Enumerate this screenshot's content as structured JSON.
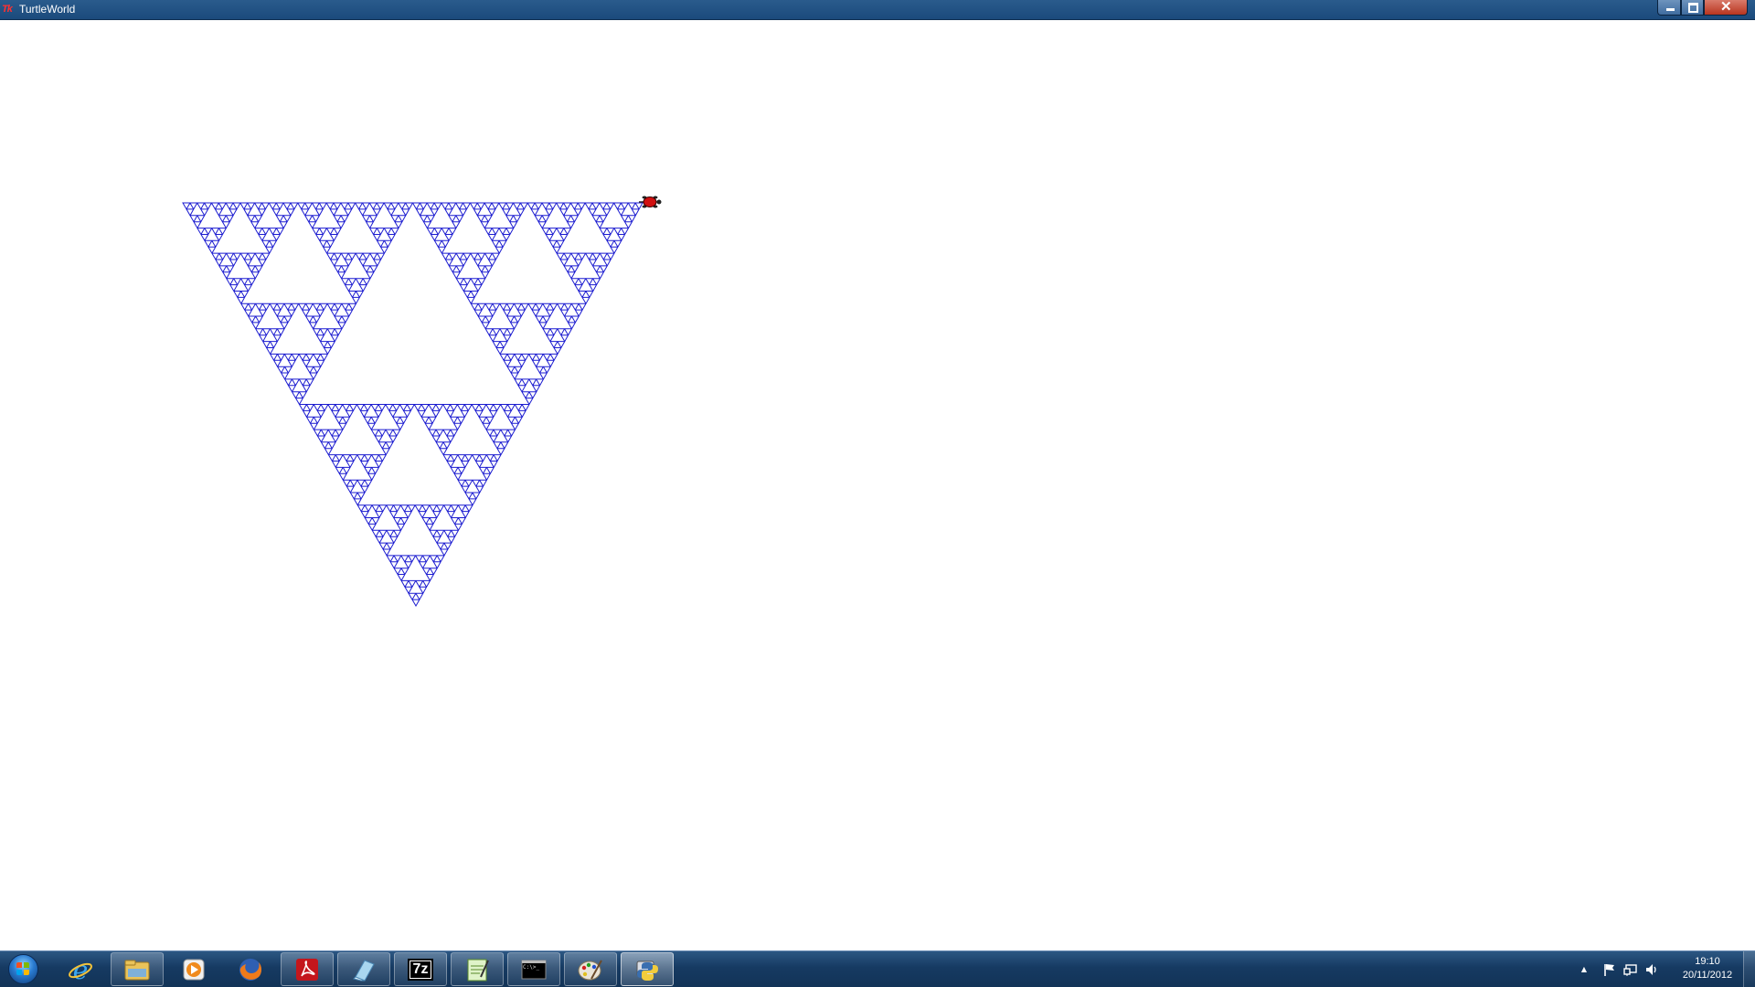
{
  "window": {
    "title": "TurtleWorld",
    "app_icon_text": "Tk",
    "caption_buttons": {
      "minimize": "minimize",
      "maximize": "maximize",
      "close": "✕"
    }
  },
  "canvas": {
    "background": "#ffffff",
    "drawing": "sierpinski-triangle",
    "line_color": "#1c1cd0",
    "recursion_depth": 6,
    "turtle_color": "#d01010"
  },
  "taskbar": {
    "start_button": "start",
    "apps": [
      {
        "name": "internet-explorer",
        "icon": "ie-icon",
        "state": "pinned"
      },
      {
        "name": "windows-explorer",
        "icon": "folder-icon",
        "state": "open"
      },
      {
        "name": "media-player",
        "icon": "media-player-icon",
        "state": "pinned"
      },
      {
        "name": "firefox",
        "icon": "firefox-icon",
        "state": "pinned"
      },
      {
        "name": "adobe-reader",
        "icon": "pdf-icon",
        "state": "open"
      },
      {
        "name": "notepad-eraser",
        "icon": "eraser-icon",
        "state": "open"
      },
      {
        "name": "7-zip",
        "icon": "7z-icon",
        "label": "7z",
        "state": "open"
      },
      {
        "name": "editor",
        "icon": "notepad-icon",
        "state": "open"
      },
      {
        "name": "command-prompt",
        "icon": "cmd-icon",
        "label": "C:\\>_",
        "state": "open"
      },
      {
        "name": "paint",
        "icon": "paint-icon",
        "state": "open"
      },
      {
        "name": "python",
        "icon": "python-icon",
        "state": "active"
      }
    ],
    "tray": {
      "show_hidden": "▲",
      "flag": "action-center",
      "network": "network",
      "volume": "volume",
      "time": "19:10",
      "date": "20/11/2012"
    }
  }
}
